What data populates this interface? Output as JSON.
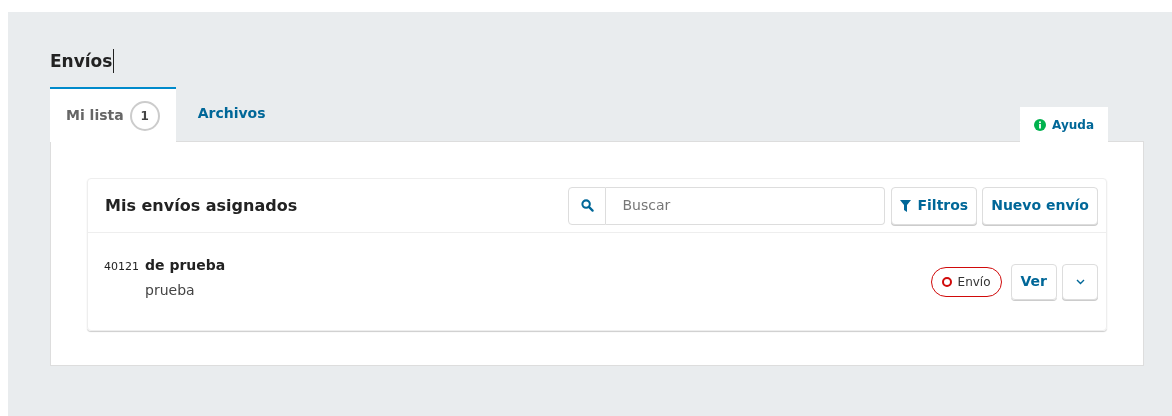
{
  "page_title": "Envíos",
  "tabs": [
    {
      "label": "Mi lista",
      "count": "1",
      "selected": true
    },
    {
      "label": "Archivos",
      "selected": false
    }
  ],
  "help_tab": {
    "label": "Ayuda"
  },
  "panel": {
    "title": "Mis envíos asignados",
    "search": {
      "placeholder": "Buscar"
    },
    "buttons": [
      {
        "kind": "filter",
        "label": "Filtros"
      },
      {
        "kind": "plain",
        "label": "Nuevo envío"
      }
    ]
  },
  "submissions": [
    {
      "id": "40121",
      "title": "de prueba",
      "author": "prueba",
      "stage": {
        "label": "Envío",
        "color": "#d00a0a"
      },
      "action": "Ver",
      "expanded": false
    }
  ]
}
